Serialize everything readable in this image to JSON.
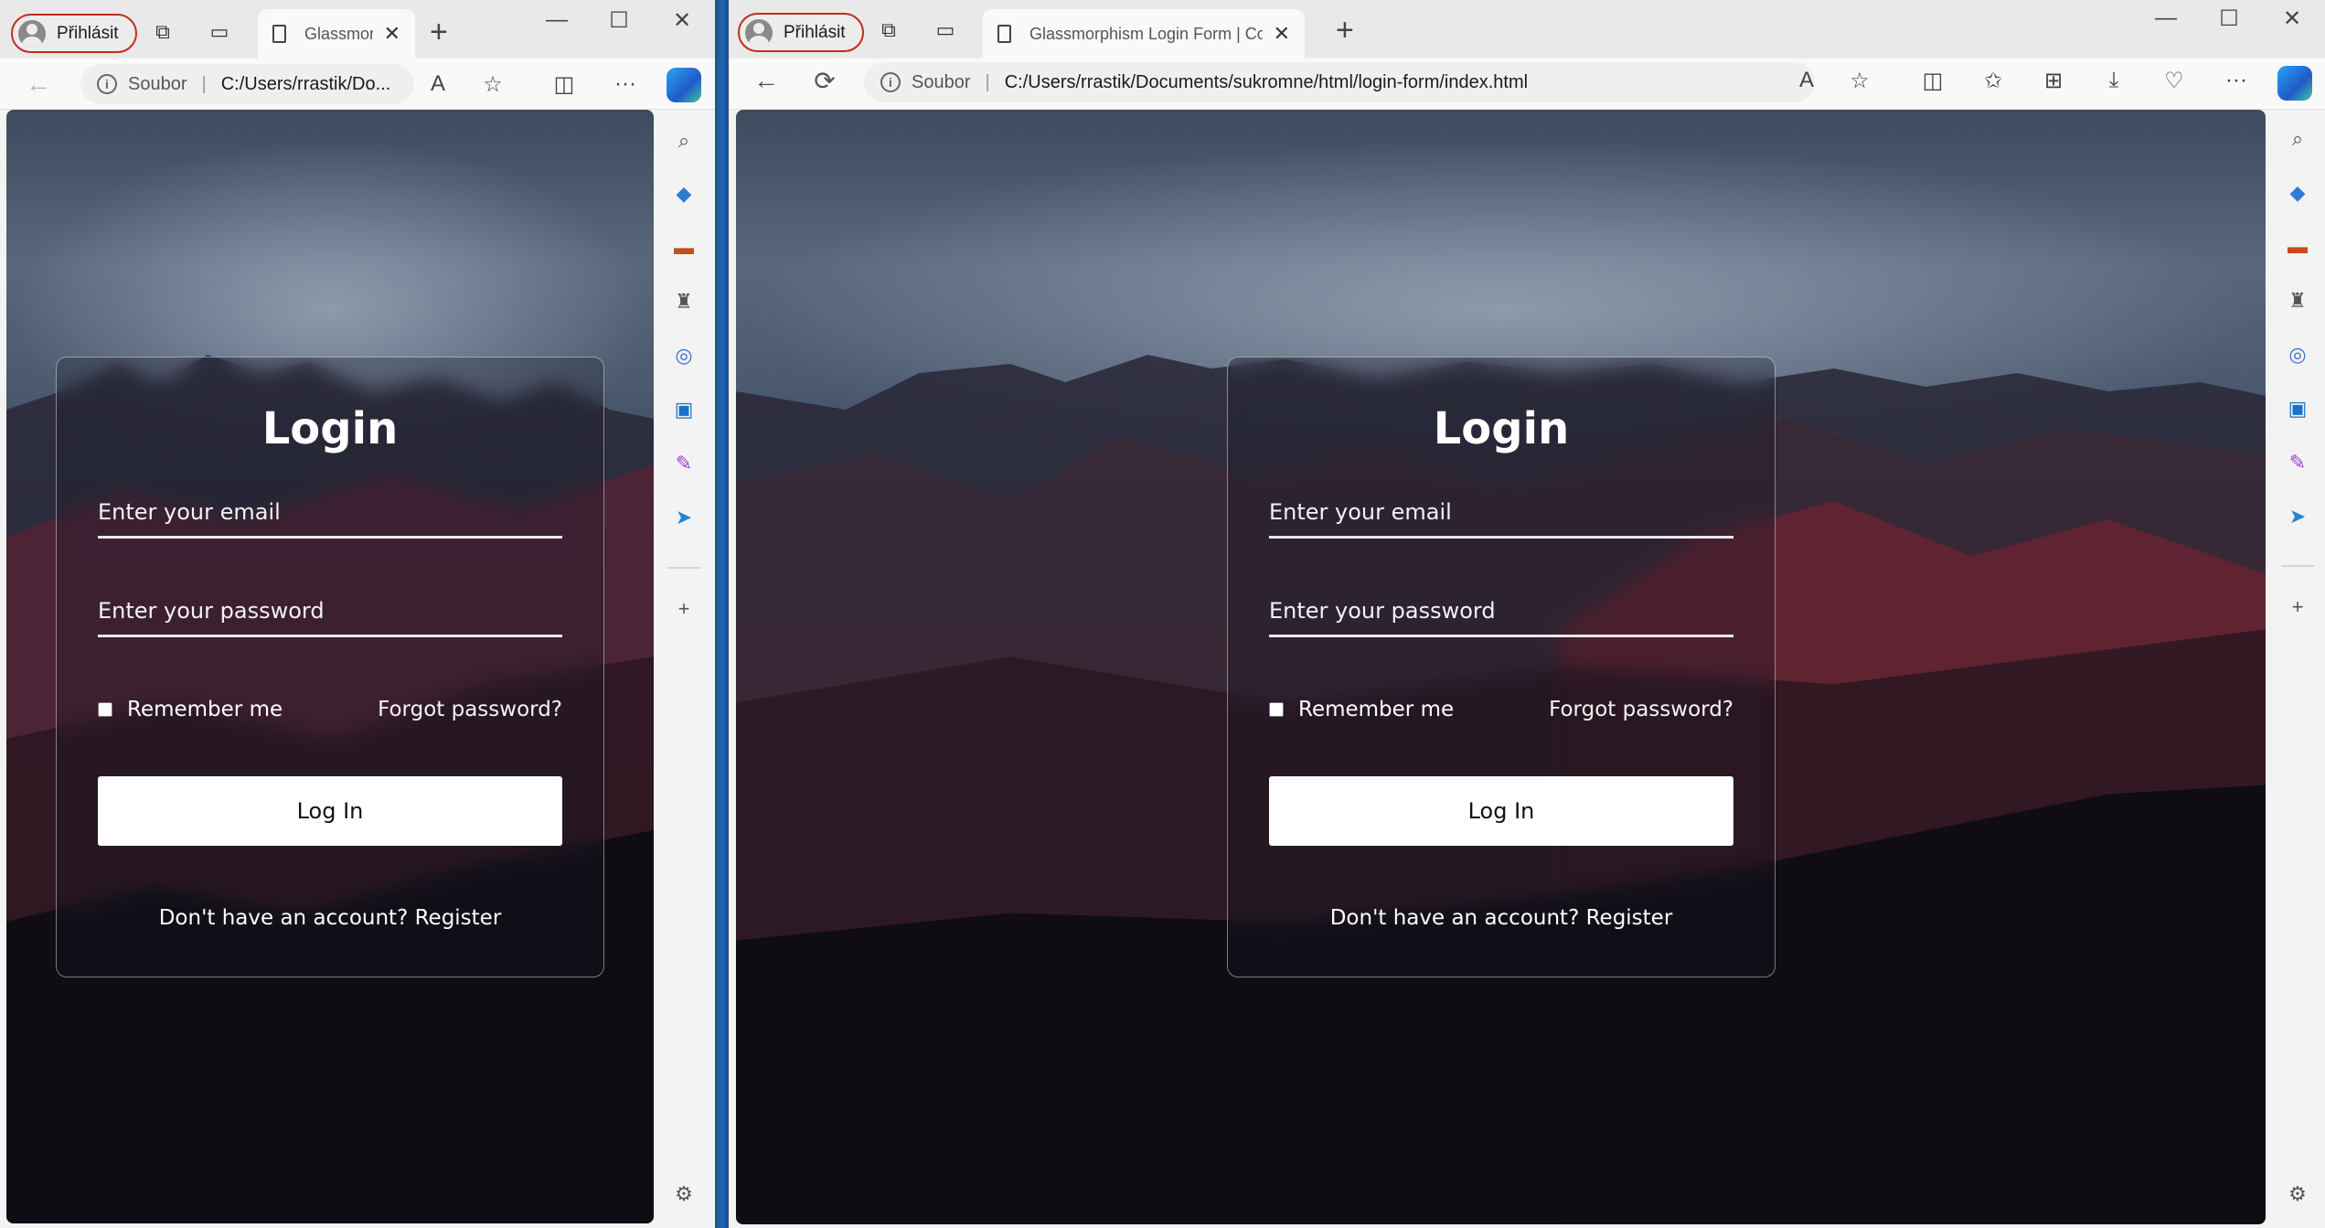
{
  "profile": {
    "label": "Přihlásit"
  },
  "left_window": {
    "tab_title": "Glassmor",
    "url_scheme": "Soubor",
    "url_path": "C:/Users/rrastik/Do..."
  },
  "right_window": {
    "tab_title": "Glassmorphism Login Form | Coc",
    "url_scheme": "Soubor",
    "url_path": "C:/Users/rrastik/Documents/sukromne/html/login-form/index.html"
  },
  "login_form": {
    "title": "Login",
    "email_placeholder": "Enter your email",
    "password_placeholder": "Enter your password",
    "remember_label": "Remember me",
    "forgot_label": "Forgot password?",
    "login_button": "Log In",
    "register_prompt": "Don't have an account?",
    "register_link": "Register"
  },
  "icons": {
    "new_tab": "+",
    "close_tab": "✕",
    "minimize": "—",
    "maximize": "☐",
    "close_window": "✕",
    "back": "←",
    "refresh": "⟳",
    "more": "···",
    "add": "+"
  },
  "colors": {
    "profile_border": "#c42b1c",
    "taskbar_blue": "#1f5fa8"
  }
}
